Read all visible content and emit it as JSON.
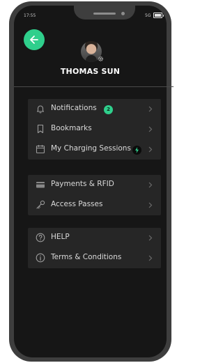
{
  "status_bar": {
    "time": "17:55",
    "network": "5G",
    "battery_level": 0.9
  },
  "profile": {
    "name": "THOMAS SUN"
  },
  "menu": {
    "group1": [
      {
        "label": "Notifications",
        "icon": "bell-icon",
        "badge": "2"
      },
      {
        "label": "Bookmarks",
        "icon": "bookmark-icon"
      },
      {
        "label": "My Charging Sessions",
        "icon": "calendar-icon",
        "status_icon": "lightning-bolt-icon"
      }
    ],
    "group2": [
      {
        "label": "Payments & RFID",
        "icon": "card-icon"
      },
      {
        "label": "Access Passes",
        "icon": "key-icon"
      }
    ],
    "group3": [
      {
        "label": "HELP",
        "icon": "help-icon"
      },
      {
        "label": "Terms & Conditions",
        "icon": "info-icon"
      }
    ]
  },
  "colors": {
    "accent": "#2fcf8c",
    "background": "#161616",
    "card": "#262626"
  }
}
